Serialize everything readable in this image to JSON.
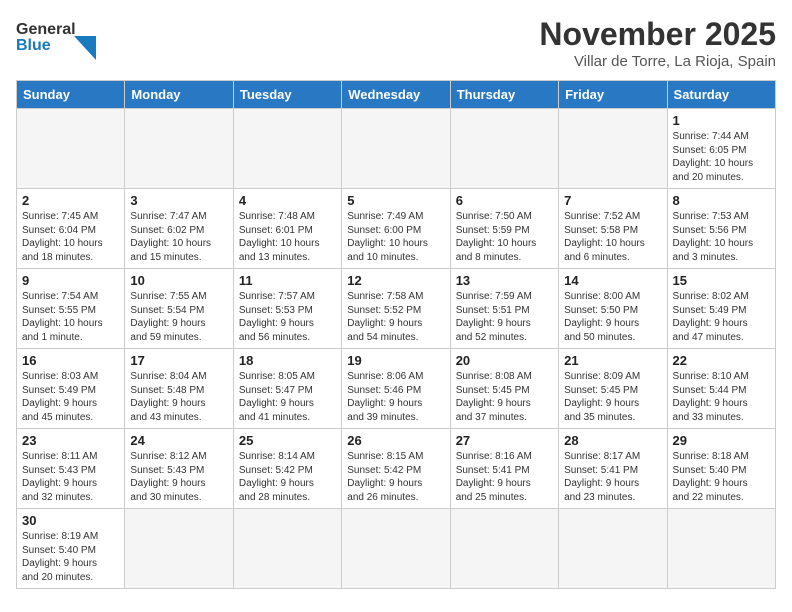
{
  "header": {
    "logo_general": "General",
    "logo_blue": "Blue",
    "month": "November 2025",
    "location": "Villar de Torre, La Rioja, Spain"
  },
  "weekdays": [
    "Sunday",
    "Monday",
    "Tuesday",
    "Wednesday",
    "Thursday",
    "Friday",
    "Saturday"
  ],
  "weeks": [
    [
      {
        "day": "",
        "info": ""
      },
      {
        "day": "",
        "info": ""
      },
      {
        "day": "",
        "info": ""
      },
      {
        "day": "",
        "info": ""
      },
      {
        "day": "",
        "info": ""
      },
      {
        "day": "",
        "info": ""
      },
      {
        "day": "1",
        "info": "Sunrise: 7:44 AM\nSunset: 6:05 PM\nDaylight: 10 hours\nand 20 minutes."
      }
    ],
    [
      {
        "day": "2",
        "info": "Sunrise: 7:45 AM\nSunset: 6:04 PM\nDaylight: 10 hours\nand 18 minutes."
      },
      {
        "day": "3",
        "info": "Sunrise: 7:47 AM\nSunset: 6:02 PM\nDaylight: 10 hours\nand 15 minutes."
      },
      {
        "day": "4",
        "info": "Sunrise: 7:48 AM\nSunset: 6:01 PM\nDaylight: 10 hours\nand 13 minutes."
      },
      {
        "day": "5",
        "info": "Sunrise: 7:49 AM\nSunset: 6:00 PM\nDaylight: 10 hours\nand 10 minutes."
      },
      {
        "day": "6",
        "info": "Sunrise: 7:50 AM\nSunset: 5:59 PM\nDaylight: 10 hours\nand 8 minutes."
      },
      {
        "day": "7",
        "info": "Sunrise: 7:52 AM\nSunset: 5:58 PM\nDaylight: 10 hours\nand 6 minutes."
      },
      {
        "day": "8",
        "info": "Sunrise: 7:53 AM\nSunset: 5:56 PM\nDaylight: 10 hours\nand 3 minutes."
      }
    ],
    [
      {
        "day": "9",
        "info": "Sunrise: 7:54 AM\nSunset: 5:55 PM\nDaylight: 10 hours\nand 1 minute."
      },
      {
        "day": "10",
        "info": "Sunrise: 7:55 AM\nSunset: 5:54 PM\nDaylight: 9 hours\nand 59 minutes."
      },
      {
        "day": "11",
        "info": "Sunrise: 7:57 AM\nSunset: 5:53 PM\nDaylight: 9 hours\nand 56 minutes."
      },
      {
        "day": "12",
        "info": "Sunrise: 7:58 AM\nSunset: 5:52 PM\nDaylight: 9 hours\nand 54 minutes."
      },
      {
        "day": "13",
        "info": "Sunrise: 7:59 AM\nSunset: 5:51 PM\nDaylight: 9 hours\nand 52 minutes."
      },
      {
        "day": "14",
        "info": "Sunrise: 8:00 AM\nSunset: 5:50 PM\nDaylight: 9 hours\nand 50 minutes."
      },
      {
        "day": "15",
        "info": "Sunrise: 8:02 AM\nSunset: 5:49 PM\nDaylight: 9 hours\nand 47 minutes."
      }
    ],
    [
      {
        "day": "16",
        "info": "Sunrise: 8:03 AM\nSunset: 5:49 PM\nDaylight: 9 hours\nand 45 minutes."
      },
      {
        "day": "17",
        "info": "Sunrise: 8:04 AM\nSunset: 5:48 PM\nDaylight: 9 hours\nand 43 minutes."
      },
      {
        "day": "18",
        "info": "Sunrise: 8:05 AM\nSunset: 5:47 PM\nDaylight: 9 hours\nand 41 minutes."
      },
      {
        "day": "19",
        "info": "Sunrise: 8:06 AM\nSunset: 5:46 PM\nDaylight: 9 hours\nand 39 minutes."
      },
      {
        "day": "20",
        "info": "Sunrise: 8:08 AM\nSunset: 5:45 PM\nDaylight: 9 hours\nand 37 minutes."
      },
      {
        "day": "21",
        "info": "Sunrise: 8:09 AM\nSunset: 5:45 PM\nDaylight: 9 hours\nand 35 minutes."
      },
      {
        "day": "22",
        "info": "Sunrise: 8:10 AM\nSunset: 5:44 PM\nDaylight: 9 hours\nand 33 minutes."
      }
    ],
    [
      {
        "day": "23",
        "info": "Sunrise: 8:11 AM\nSunset: 5:43 PM\nDaylight: 9 hours\nand 32 minutes."
      },
      {
        "day": "24",
        "info": "Sunrise: 8:12 AM\nSunset: 5:43 PM\nDaylight: 9 hours\nand 30 minutes."
      },
      {
        "day": "25",
        "info": "Sunrise: 8:14 AM\nSunset: 5:42 PM\nDaylight: 9 hours\nand 28 minutes."
      },
      {
        "day": "26",
        "info": "Sunrise: 8:15 AM\nSunset: 5:42 PM\nDaylight: 9 hours\nand 26 minutes."
      },
      {
        "day": "27",
        "info": "Sunrise: 8:16 AM\nSunset: 5:41 PM\nDaylight: 9 hours\nand 25 minutes."
      },
      {
        "day": "28",
        "info": "Sunrise: 8:17 AM\nSunset: 5:41 PM\nDaylight: 9 hours\nand 23 minutes."
      },
      {
        "day": "29",
        "info": "Sunrise: 8:18 AM\nSunset: 5:40 PM\nDaylight: 9 hours\nand 22 minutes."
      }
    ],
    [
      {
        "day": "30",
        "info": "Sunrise: 8:19 AM\nSunset: 5:40 PM\nDaylight: 9 hours\nand 20 minutes."
      },
      {
        "day": "",
        "info": ""
      },
      {
        "day": "",
        "info": ""
      },
      {
        "day": "",
        "info": ""
      },
      {
        "day": "",
        "info": ""
      },
      {
        "day": "",
        "info": ""
      },
      {
        "day": "",
        "info": ""
      }
    ]
  ]
}
